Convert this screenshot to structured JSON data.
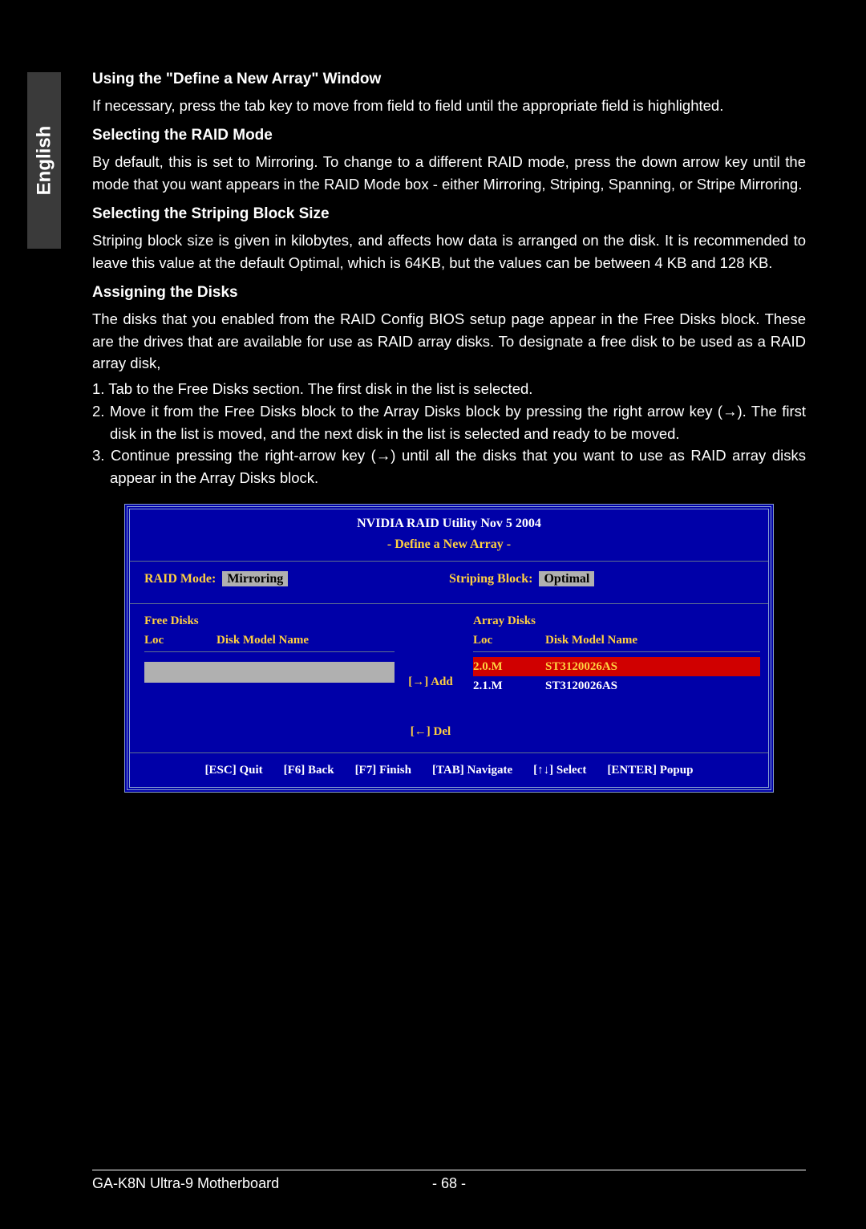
{
  "lang_tab": "English",
  "sections": {
    "h1": "Using the \"Define a New Array\" Window",
    "p1": "If necessary, press the tab key to move from field to field until the appropriate field is highlighted.",
    "h2": "Selecting the RAID Mode",
    "p2": "By default, this is set to Mirroring. To change to a different RAID mode, press the down arrow key until the mode that you want appears in the RAID Mode box - either Mirroring, Striping, Spanning, or Stripe Mirroring.",
    "h3": "Selecting the Striping Block Size",
    "p3": "Striping block size is given in kilobytes, and affects how data is arranged on the disk. It is recommended to leave this value at the default Optimal, which is 64KB, but the values can be between 4 KB and 128 KB.",
    "h4": "Assigning the Disks",
    "p4": "The disks that you enabled from the RAID Config BIOS setup page appear in the Free Disks block. These are the drives that are available for use as RAID array disks. To designate a free disk to be used as a RAID array disk,",
    "li1": "1. Tab to the Free Disks section. The first disk in the list is selected.",
    "li2": "2. Move it from the Free Disks block to the Array Disks block by pressing the right arrow key (→). The first disk in the list is moved, and the next disk in the list is selected and ready to be moved.",
    "li3": "3. Continue pressing the right-arrow key (→) until all the disks that you want to use as RAID array disks appear in the Array Disks block."
  },
  "raid": {
    "title": "NVIDIA RAID Utility   Nov 5 2004",
    "subtitle": "- Define a New Array -",
    "mode_label": "RAID Mode:",
    "mode_value": "Mirroring",
    "block_label": "Striping Block:",
    "block_value": "Optimal",
    "free_title": "Free Disks",
    "array_title": "Array Disks",
    "col_loc": "Loc",
    "col_model": "Disk Model Name",
    "add_label": "[→] Add",
    "del_label": "[←] Del",
    "array_rows": [
      {
        "loc": "2.0.M",
        "model": "ST3120026AS",
        "selected": true
      },
      {
        "loc": "2.1.M",
        "model": "ST3120026AS",
        "selected": false
      }
    ],
    "keys": {
      "esc": "[ESC] Quit",
      "f6": "[F6] Back",
      "f7": "[F7] Finish",
      "tab": "[TAB] Navigate",
      "arrows": "[↑↓] Select",
      "enter": "[ENTER] Popup"
    }
  },
  "footer": {
    "left": "GA-K8N Ultra-9 Motherboard",
    "page": "- 68 -"
  }
}
